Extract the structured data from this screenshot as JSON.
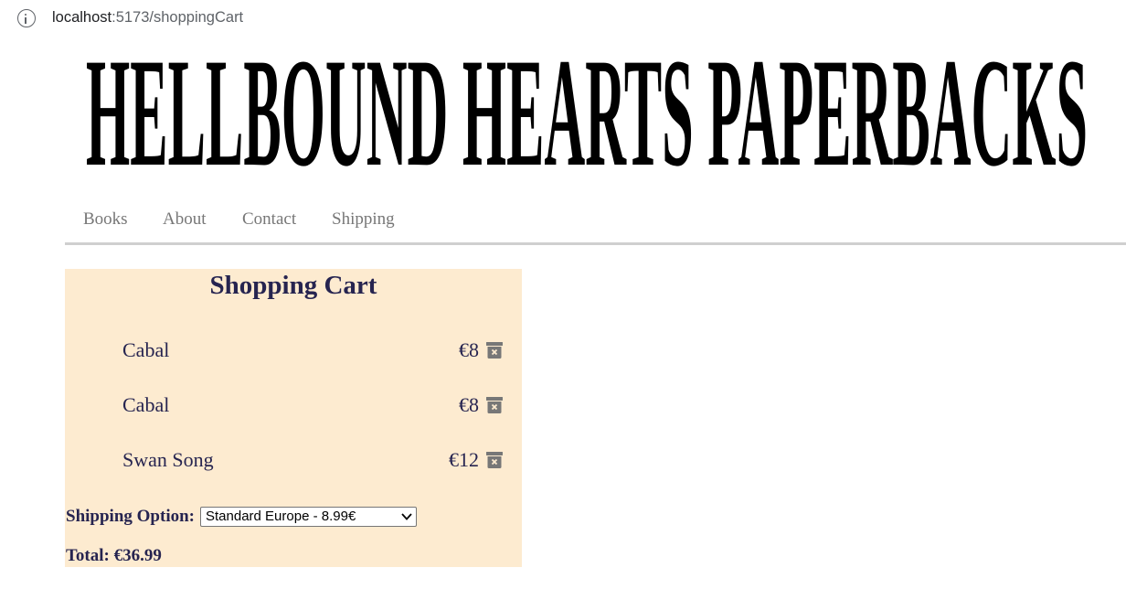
{
  "browser": {
    "url_host": "localhost",
    "url_path": ":5173/shoppingCart"
  },
  "logo": {
    "text": "HELLBOUND HEARTS PAPERBACKS"
  },
  "nav": {
    "items": [
      {
        "label": "Books"
      },
      {
        "label": "About"
      },
      {
        "label": "Contact"
      },
      {
        "label": "Shipping"
      }
    ]
  },
  "cart": {
    "title": "Shopping Cart",
    "items": [
      {
        "name": "Cabal",
        "price": "€8"
      },
      {
        "name": "Cabal",
        "price": "€8"
      },
      {
        "name": "Swan Song",
        "price": "€12"
      }
    ],
    "shipping_label": "Shipping Option:",
    "shipping_selected": "Standard Europe - 8.99€",
    "total": "Total: €36.99"
  },
  "colors": {
    "cart_background": "#fdebd0",
    "cart_text": "#262450",
    "nav_text": "#777777",
    "trash_icon": "#777777"
  },
  "icons": [
    "info-icon",
    "trash-icon",
    "chevron-down-icon"
  ]
}
